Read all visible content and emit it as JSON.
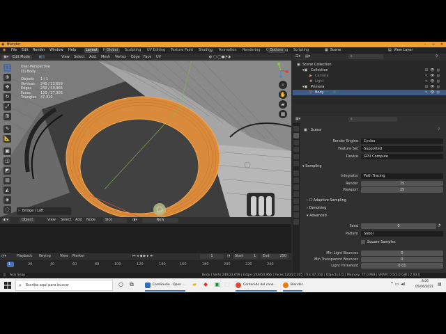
{
  "window": {
    "title": "Blender"
  },
  "menubar": {
    "menus": [
      "File",
      "Edit",
      "Render",
      "Window",
      "Help"
    ],
    "workspaces": [
      "Layout",
      "Modeling",
      "Sculpting",
      "UV Editing",
      "Texture Paint",
      "Shading",
      "Animation",
      "Rendering",
      "Compositing",
      "Scripting"
    ],
    "scene": "Scene",
    "view_layer": "View Layer"
  },
  "viewport_header": {
    "mode": "Edit Mode",
    "menus": [
      "View",
      "Select",
      "Add",
      "Mesh",
      "Vertex",
      "Edge",
      "Face",
      "UV"
    ],
    "transform": "Global",
    "options": "Options"
  },
  "viewport_overlay": {
    "view_name": "User Perspective",
    "object_name": "(1) Body",
    "stats": [
      {
        "label": "Objects",
        "value": "1 / 1"
      },
      {
        "label": "Vertices",
        "value": "240 / 23,659"
      },
      {
        "label": "Edges",
        "value": "240 / 50,966"
      },
      {
        "label": "Faces",
        "value": "120 / 27,305"
      },
      {
        "label": "Triangles",
        "value": "47,310"
      }
    ],
    "operator_panel": "Bridge / Loft"
  },
  "editor_header": {
    "items": [
      "Object",
      "View",
      "Select",
      "Add",
      "Node"
    ],
    "slot": "Slot",
    "new_button": "New"
  },
  "timeline": {
    "menus": [
      "Playback",
      "Keying",
      "View",
      "Marker"
    ],
    "current_frame": "1",
    "start_label": "Start",
    "start": "1",
    "end_label": "End",
    "end": "250",
    "ticks": [
      "1",
      "20",
      "40",
      "60",
      "80",
      "100",
      "120",
      "140",
      "160",
      "180",
      "200",
      "220",
      "240"
    ]
  },
  "statusbar": {
    "left": "Axis Snap",
    "right": "Body | Verts:240/23,659 | Edges:240/50,966 | Faces:120/27,305 | Tris:47,310 | Objects:1/1 | Memory: 77.0 MiB | VRAM: 0.5/3.0 GiB | 2.93.0"
  },
  "outliner": {
    "title": "Scene Collection",
    "rows": [
      {
        "label": "Collection",
        "indent": 1
      },
      {
        "label": "Camera",
        "indent": 2
      },
      {
        "label": "Light",
        "indent": 2
      },
      {
        "label": "Primera",
        "indent": 1
      },
      {
        "label": "Body",
        "indent": 2,
        "selected": true
      }
    ]
  },
  "properties": {
    "breadcrumb": "Scene",
    "render_engine_label": "Render Engine",
    "render_engine": "Cycles",
    "feature_set_label": "Feature Set",
    "feature_set": "Supported",
    "device_label": "Device",
    "device": "GPU Compute",
    "sampling_header": "Sampling",
    "integrator_label": "Integrator",
    "integrator": "Path Tracing",
    "render_label": "Render",
    "render_samples": "75",
    "viewport_label": "Viewport",
    "viewport_samples": "25",
    "adaptive_sampling": "Adaptive Sampling",
    "denoising": "Denoising",
    "advanced": "Advanced",
    "seed_label": "Seed",
    "seed": "0",
    "pattern_label": "Pattern",
    "pattern": "Sobol",
    "square_samples": "Square Samples",
    "min_light_bounces_label": "Min Light Bounces",
    "min_light_bounces": "0",
    "min_transparent_bounces_label": "Min Transparent Bounces",
    "min_transparent_bounces": "0",
    "light_threshold_label": "Light Threshold",
    "light_threshold": "0.01"
  },
  "taskbar": {
    "search_placeholder": "Escribe aquí para buscar",
    "apps": [
      {
        "label": "CamStudio - Open ...",
        "color": "#2f6fb8"
      },
      {
        "label": "Contenido del cana...",
        "color": "#d94a3a"
      },
      {
        "label": "Blender",
        "color": "#e87d0d"
      }
    ],
    "time": "8:06",
    "date": "05/06/2021"
  },
  "colors": {
    "selection_orange": "#e8912d",
    "active_blue": "#3e5a86",
    "blender_orange": "#f0a030"
  }
}
